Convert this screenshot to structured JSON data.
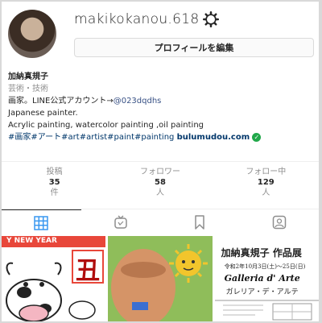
{
  "profile": {
    "username": "makikokanou.618",
    "edit_label": "プロフィールを編集",
    "display_name": "加納真規子",
    "category": "芸術・技術",
    "bio_line1_prefix": "画家。LINE公式アカウント→",
    "line_id": "@023dqdhs",
    "bio_line2": "Japanese painter.",
    "bio_line3": "Acrylic painting, watercolor painting ,oil painting",
    "hashtags": "#画家#アート#art#artist#paint#painting",
    "website": "bulumudou.com"
  },
  "stats": [
    {
      "label": "投稿",
      "value": "35",
      "unit": "件"
    },
    {
      "label": "フォロワー",
      "value": "58",
      "unit": "人"
    },
    {
      "label": "フォロー中",
      "value": "129",
      "unit": "人"
    }
  ],
  "tabs": [
    {
      "icon": "grid-icon",
      "active": true
    },
    {
      "icon": "igtv-icon",
      "active": false
    },
    {
      "icon": "bookmark-icon",
      "active": false
    },
    {
      "icon": "tagged-icon",
      "active": false
    }
  ],
  "posts": {
    "post1_banner": "Y NEW YEAR",
    "post1_kanji": "丑",
    "post3_title": "加納真規子 作品展",
    "post3_date": "令和2年10月3日(土)～25日(日)",
    "post3_gallery": "Galleria d' Arte",
    "post3_gallery_kana": "ガレリア・デ・アルテ"
  },
  "colors": {
    "link": "#00376b",
    "verified": "#21a84a",
    "muted": "#8e8e8e"
  }
}
